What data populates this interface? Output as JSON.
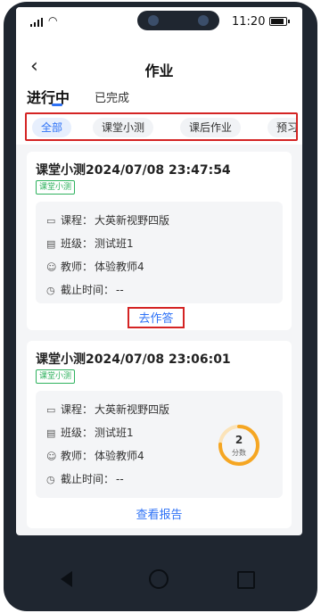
{
  "status_bar": {
    "time": "11:20"
  },
  "header": {
    "title": "作业"
  },
  "tabs": [
    {
      "label": "进行中",
      "active": true
    },
    {
      "label": "已完成",
      "active": false
    }
  ],
  "filters": [
    "全部",
    "课堂小测",
    "课后作业",
    "预习"
  ],
  "cards": [
    {
      "title": "课堂小测2024/07/08 23:47:54",
      "tag": "课堂小测",
      "course": {
        "label": "课程：",
        "value": "大英新视野四版"
      },
      "class": {
        "label": "班级：",
        "value": "测试班1"
      },
      "teacher": {
        "label": "教师：",
        "value": "体验教师4"
      },
      "deadline": {
        "label": "截止时间：",
        "value": "--"
      },
      "action": "去作答"
    },
    {
      "title": "课堂小测2024/07/08 23:06:01",
      "tag": "课堂小测",
      "course": {
        "label": "课程：",
        "value": "大英新视野四版"
      },
      "class": {
        "label": "班级：",
        "value": "测试班1"
      },
      "teacher": {
        "label": "教师：",
        "value": "体验教师4"
      },
      "deadline": {
        "label": "截止时间：",
        "value": "--"
      },
      "score": {
        "value": "2",
        "label": "分数"
      },
      "action": "查看报告"
    }
  ],
  "colors": {
    "accent": "#2e72f6",
    "highlight_box": "#d42424",
    "tag_green": "#2fb25e",
    "score_ring": "#f5a623"
  }
}
